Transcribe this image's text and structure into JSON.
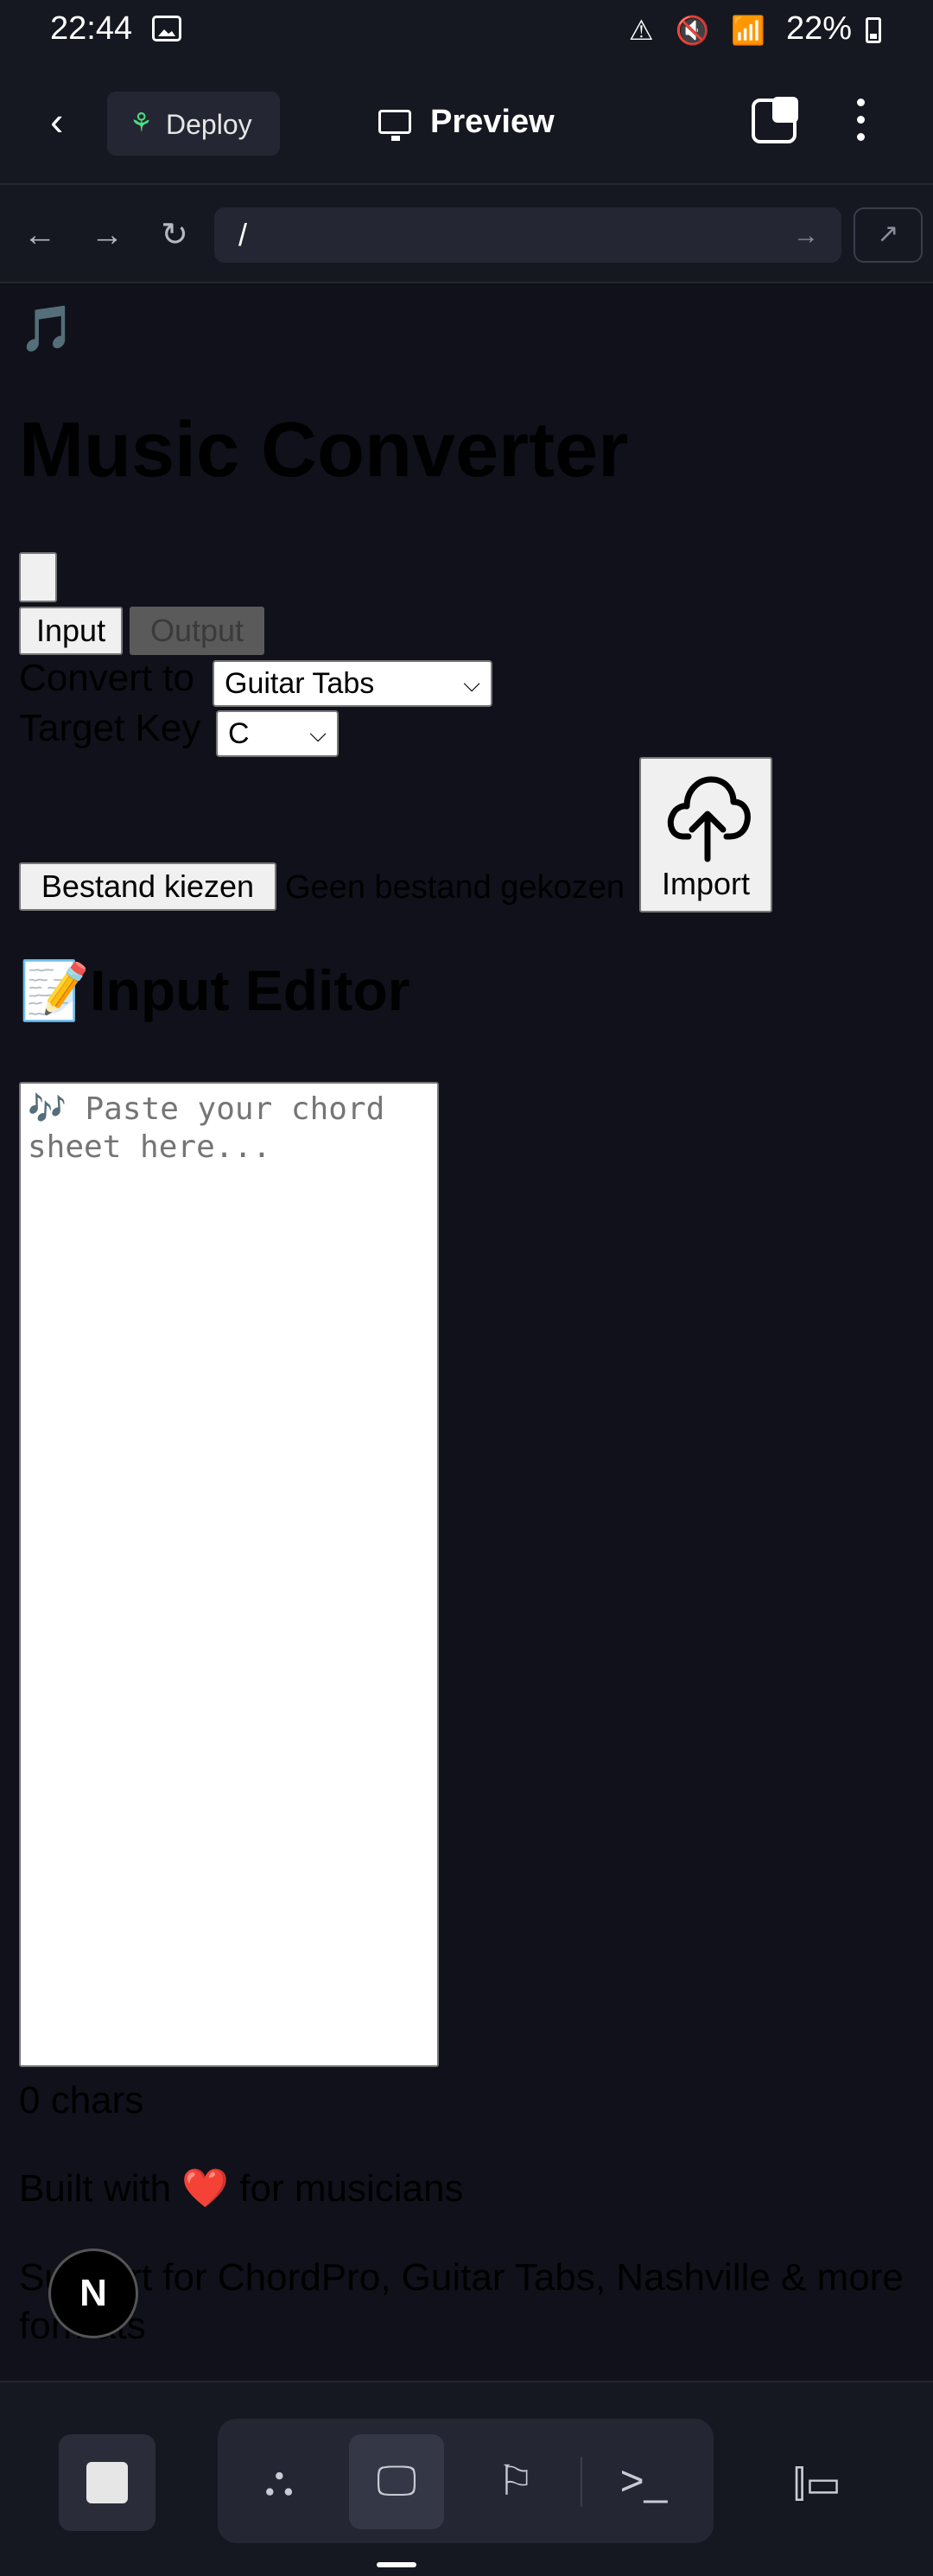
{
  "status_bar": {
    "time": "22:44",
    "icons": "⚠ 🔇 📶",
    "battery_text": "22%"
  },
  "app_header": {
    "deploy_label": "Deploy",
    "preview_label": "Preview"
  },
  "browser_bar": {
    "url": "/"
  },
  "page": {
    "logo_emoji": "🎵",
    "title": "Music Converter",
    "tabs": {
      "input_label": "Input",
      "output_label": "Output"
    },
    "convert_to": {
      "label": "Convert to",
      "selected": "Guitar Tabs"
    },
    "target_key": {
      "label": "Target Key",
      "selected": "C"
    },
    "file_picker": {
      "button_label": "Bestand kiezen",
      "status": "Geen bestand gekozen"
    },
    "import_label": "Import",
    "editor_heading": "📝Input Editor",
    "editor_placeholder": "🎶 Paste your chord sheet here...",
    "char_count": "0 chars",
    "footer_built": "Built with ❤️ for musicians",
    "footer_support": "Support for ChordPro, Guitar Tabs, Nashville & more formats",
    "next_badge": "N"
  },
  "colors": {
    "background": "#10111a",
    "chrome": "#161821",
    "deploy_icon": "#4ade80"
  }
}
